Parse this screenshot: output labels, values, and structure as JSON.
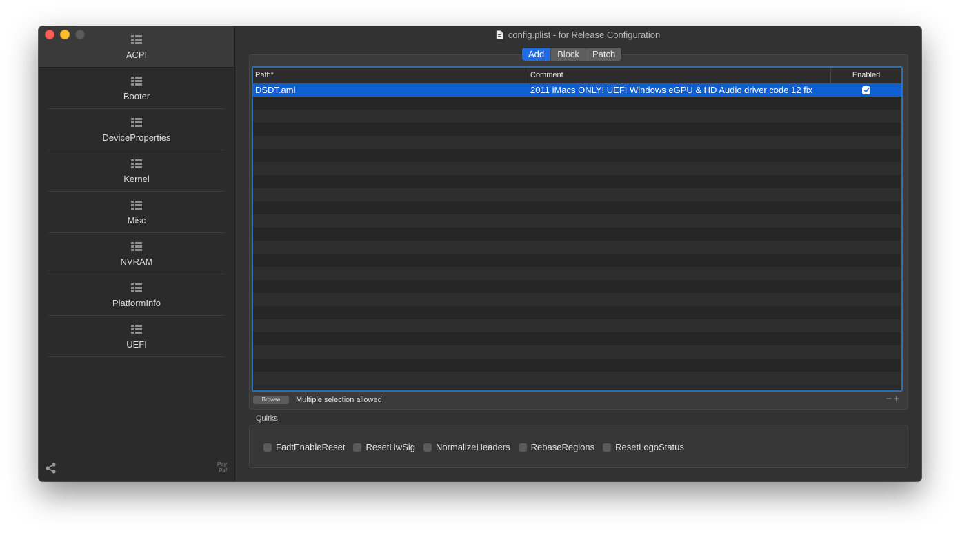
{
  "window": {
    "title": "config.plist - for Release Configuration"
  },
  "sidebar": {
    "items": [
      {
        "label": "ACPI",
        "active": true
      },
      {
        "label": "Booter"
      },
      {
        "label": "DeviceProperties"
      },
      {
        "label": "Kernel"
      },
      {
        "label": "Misc"
      },
      {
        "label": "NVRAM"
      },
      {
        "label": "PlatformInfo"
      },
      {
        "label": "UEFI"
      }
    ],
    "paypal_line1": "Pay",
    "paypal_line2": "Pal"
  },
  "tabs": [
    {
      "label": "Add",
      "selected": true
    },
    {
      "label": "Block"
    },
    {
      "label": "Patch"
    }
  ],
  "table": {
    "columns": [
      "Path*",
      "Comment",
      "Enabled"
    ],
    "rows": [
      {
        "path": "DSDT.aml",
        "comment": "2011 iMacs ONLY!  UEFI Windows eGPU & HD Audio driver code 12 fix",
        "enabled": true
      }
    ],
    "empty_rows": 22
  },
  "footer": {
    "browse_label": "Browse",
    "hint": "Multiple selection allowed",
    "minus": "−",
    "plus": "+"
  },
  "quirks": {
    "title": "Quirks",
    "items": [
      "FadtEnableReset",
      "ResetHwSig",
      "NormalizeHeaders",
      "RebaseRegions",
      "ResetLogoStatus"
    ]
  },
  "colors": {
    "accent": "#1f6ce3",
    "selection": "#0f5fd2",
    "table_focus_ring": "#2e6fb0"
  }
}
